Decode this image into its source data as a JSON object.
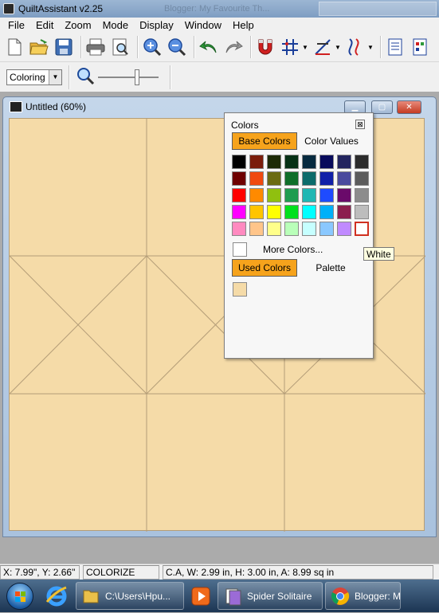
{
  "app": {
    "title": "QuiltAssistant v2.25",
    "background_tab": "Blogger: My Favourite Th..."
  },
  "menu": [
    "File",
    "Edit",
    "Zoom",
    "Mode",
    "Display",
    "Window",
    "Help"
  ],
  "toolbar": {
    "icons": [
      "new-file-icon",
      "open-folder-icon",
      "save-icon",
      "print-icon",
      "print-preview-icon",
      "zoom-in-icon",
      "zoom-out-icon",
      "undo-icon",
      "redo-icon",
      "magnet-snap-icon",
      "grid-icon",
      "ruler-angle-icon",
      "curve-line-icon",
      "document-list-icon",
      "palette-page-icon"
    ]
  },
  "toolbar2": {
    "mode_value": "Coloring",
    "zoom_level": 0.65
  },
  "document": {
    "title": "Untitled (60%)"
  },
  "colors_panel": {
    "title": "Colors",
    "close_label": "⊠",
    "tab_base": "Base Colors",
    "tab_values": "Color Values",
    "more_colors_label": "More Colors...",
    "tab_used": "Used Colors",
    "tab_palette": "Palette",
    "swatches": [
      "#000000",
      "#7b1d0b",
      "#1d2a06",
      "#063116",
      "#062a3f",
      "#080b5c",
      "#23255f",
      "#2b2b2b",
      "#6e0000",
      "#f04a10",
      "#6b6b12",
      "#0f6e2a",
      "#0c6b6b",
      "#1020a8",
      "#4a4a9e",
      "#5c5c5c",
      "#ff0000",
      "#ff8a00",
      "#90c00f",
      "#1f9c50",
      "#1fb7b3",
      "#1e4bff",
      "#6a0a6a",
      "#8c8c8c",
      "#ff00ff",
      "#ffc400",
      "#ffff00",
      "#00e01e",
      "#00ffff",
      "#00b0f8",
      "#8c1e4e",
      "#bdbdbd",
      "#ff8ac0",
      "#ffc58a",
      "#ffff8a",
      "#b9ffb9",
      "#c6ffff",
      "#8ac8ff",
      "#c08aff",
      "#ffffff"
    ],
    "selected_swatch": "#ffffff",
    "used_colors": [
      "#f5dba8"
    ]
  },
  "tooltip": "White",
  "statusbar": {
    "coords": "X: 7.99\", Y: 2.66\"",
    "mode": "COLORIZE",
    "info": "C.A, W: 2.99 in, H: 3.00 in, A: 8.99 sq in"
  },
  "taskbar": {
    "explorer_label": "C:\\Users\\Hpu...",
    "solitaire_label": "Spider Solitaire",
    "chrome_label": "Blogger: M"
  },
  "colors": {
    "quilt_fill": "#f5dba8",
    "quilt_line": "#b49d78",
    "accent_tab": "#f6a31c"
  }
}
